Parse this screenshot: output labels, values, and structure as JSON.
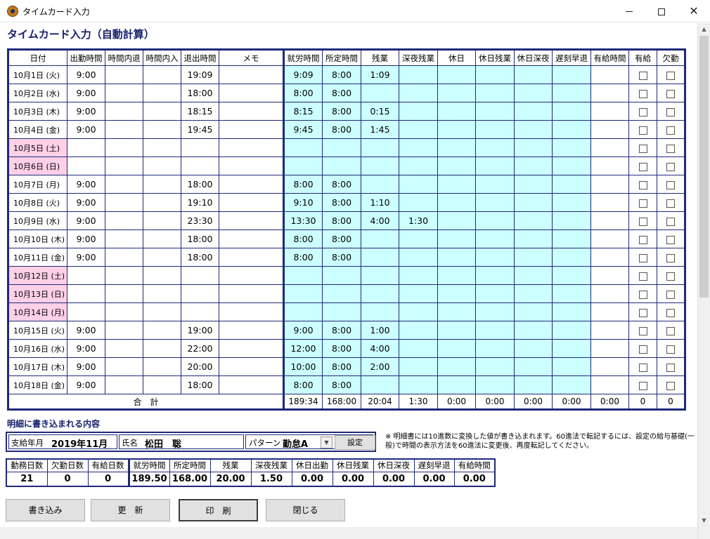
{
  "window": {
    "title": "タイムカード入力"
  },
  "form_title": "タイムカード入力（自動計算）",
  "table": {
    "headers": [
      "日付",
      "出勤時間",
      "時間内退",
      "時間内入",
      "退出時間",
      "メモ",
      "就労時間",
      "所定時間",
      "残業",
      "深夜残業",
      "休日",
      "休日残業",
      "休日深夜",
      "遅刻早退",
      "有給時間",
      "有給",
      "欠勤"
    ],
    "rows": [
      {
        "date": "10月1日 (火)",
        "in": "9:00",
        "out": "19:09",
        "work": "9:09",
        "scheduled": "8:00",
        "overtime": "1:09",
        "night_overtime": "",
        "weekend": false
      },
      {
        "date": "10月2日 (水)",
        "in": "9:00",
        "out": "18:00",
        "work": "8:00",
        "scheduled": "8:00",
        "overtime": "",
        "night_overtime": "",
        "weekend": false
      },
      {
        "date": "10月3日 (木)",
        "in": "9:00",
        "out": "18:15",
        "work": "8:15",
        "scheduled": "8:00",
        "overtime": "0:15",
        "night_overtime": "",
        "weekend": false
      },
      {
        "date": "10月4日 (金)",
        "in": "9:00",
        "out": "19:45",
        "work": "9:45",
        "scheduled": "8:00",
        "overtime": "1:45",
        "night_overtime": "",
        "weekend": false
      },
      {
        "date": "10月5日 (土)",
        "in": "",
        "out": "",
        "work": "",
        "scheduled": "",
        "overtime": "",
        "night_overtime": "",
        "weekend": true
      },
      {
        "date": "10月6日 (日)",
        "in": "",
        "out": "",
        "work": "",
        "scheduled": "",
        "overtime": "",
        "night_overtime": "",
        "weekend": true
      },
      {
        "date": "10月7日 (月)",
        "in": "9:00",
        "out": "18:00",
        "work": "8:00",
        "scheduled": "8:00",
        "overtime": "",
        "night_overtime": "",
        "weekend": false
      },
      {
        "date": "10月8日 (火)",
        "in": "9:00",
        "out": "19:10",
        "work": "9:10",
        "scheduled": "8:00",
        "overtime": "1:10",
        "night_overtime": "",
        "weekend": false
      },
      {
        "date": "10月9日 (水)",
        "in": "9:00",
        "out": "23:30",
        "work": "13:30",
        "scheduled": "8:00",
        "overtime": "4:00",
        "night_overtime": "1:30",
        "weekend": false
      },
      {
        "date": "10月10日 (木)",
        "in": "9:00",
        "out": "18:00",
        "work": "8:00",
        "scheduled": "8:00",
        "overtime": "",
        "night_overtime": "",
        "weekend": false
      },
      {
        "date": "10月11日 (金)",
        "in": "9:00",
        "out": "18:00",
        "work": "8:00",
        "scheduled": "8:00",
        "overtime": "",
        "night_overtime": "",
        "weekend": false
      },
      {
        "date": "10月12日 (土)",
        "in": "",
        "out": "",
        "work": "",
        "scheduled": "",
        "overtime": "",
        "night_overtime": "",
        "weekend": true
      },
      {
        "date": "10月13日 (日)",
        "in": "",
        "out": "",
        "work": "",
        "scheduled": "",
        "overtime": "",
        "night_overtime": "",
        "weekend": true
      },
      {
        "date": "10月14日 (月)",
        "in": "",
        "out": "",
        "work": "",
        "scheduled": "",
        "overtime": "",
        "night_overtime": "",
        "weekend": true
      },
      {
        "date": "10月15日 (火)",
        "in": "9:00",
        "out": "19:00",
        "work": "9:00",
        "scheduled": "8:00",
        "overtime": "1:00",
        "night_overtime": "",
        "weekend": false
      },
      {
        "date": "10月16日 (水)",
        "in": "9:00",
        "out": "22:00",
        "work": "12:00",
        "scheduled": "8:00",
        "overtime": "4:00",
        "night_overtime": "",
        "weekend": false
      },
      {
        "date": "10月17日 (木)",
        "in": "9:00",
        "out": "20:00",
        "work": "10:00",
        "scheduled": "8:00",
        "overtime": "2:00",
        "night_overtime": "",
        "weekend": false
      },
      {
        "date": "10月18日 (金)",
        "in": "9:00",
        "out": "18:00",
        "work": "8:00",
        "scheduled": "8:00",
        "overtime": "",
        "night_overtime": "",
        "weekend": false
      }
    ],
    "totals": {
      "label": "合　計",
      "values": [
        "189:34",
        "168:00",
        "20:04",
        "1:30",
        "0:00",
        "0:00",
        "0:00",
        "0:00",
        "0:00",
        "0",
        "0"
      ]
    }
  },
  "detail": {
    "section_title": "明細に書き込まれる内容",
    "pay_month_label": "支給年月",
    "pay_month": "2019年11月",
    "name_label": "氏名",
    "name": "松田　聡",
    "pattern_label": "パターン",
    "pattern_value": "勤怠A",
    "set_button": "設定",
    "note": "※ 明細書には10進数に変換した値が書き込まれます。60進法で転記するには、設定の給与基礎(一般)で時間の表示方法を60進法に変更後、再度転記してください。"
  },
  "summary": {
    "headers": [
      "勤務日数",
      "欠勤日数",
      "有給日数",
      "就労時間",
      "所定時間",
      "残業",
      "深夜残業",
      "休日出勤",
      "休日残業",
      "休日深夜",
      "遅刻早退",
      "有給時間"
    ],
    "values": [
      "21",
      "0",
      "0",
      "189.50",
      "168.00",
      "20.00",
      "1.50",
      "0.00",
      "0.00",
      "0.00",
      "0.00",
      "0.00"
    ]
  },
  "buttons": {
    "write": "書き込み",
    "refresh": "更　新",
    "print": "印　刷",
    "close": "閉じる"
  }
}
